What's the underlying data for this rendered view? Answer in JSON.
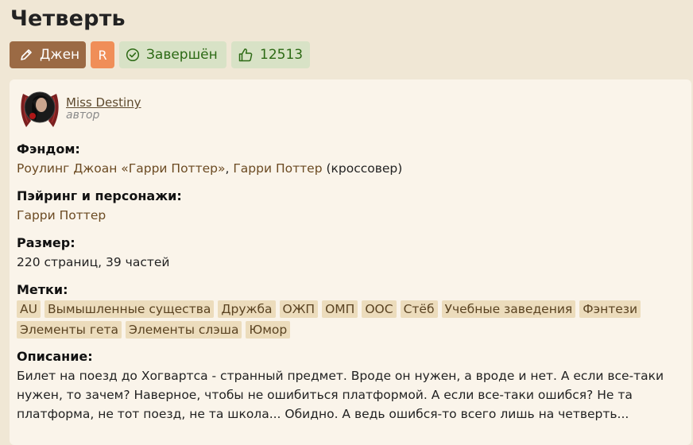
{
  "title": "Четверть",
  "badges": {
    "direction": "Джен",
    "rating": "R",
    "status": "Завершён",
    "likes": "12513"
  },
  "author": {
    "name": "Miss Destiny",
    "role": "автор"
  },
  "fandom": {
    "label": "Фэндом:",
    "link1": "Роулинг Джоан «Гарри Поттер»",
    "sep": ", ",
    "link2": "Гарри Поттер",
    "suffix": " (кроссовер)"
  },
  "pairing": {
    "label": "Пэйринг и персонажи:",
    "value": "Гарри Поттер"
  },
  "size": {
    "label": "Размер:",
    "value": "220 страниц, 39 частей"
  },
  "tags": {
    "label": "Метки:",
    "items": [
      "AU",
      "Вымышленные существа",
      "Дружба",
      "ОЖП",
      "ОМП",
      "ООС",
      "Стёб",
      "Учебные заведения",
      "Фэнтези",
      "Элементы гета",
      "Элементы слэша",
      "Юмор"
    ]
  },
  "description": {
    "label": "Описание:",
    "text": "Билет на поезд до Хогвартса - странный предмет. Вроде он нужен, а вроде и нет. А если все-таки нужен, то зачем? Наверное, чтобы не ошибиться платформой. А если все-таки ошибся? Не та платформа, не тот поезд, не та школа... Обидно. А ведь ошибся-то всего лишь на четверть..."
  },
  "colors": {
    "page_bg": "#f0e7d5",
    "card_bg": "#faf4ea",
    "gen_badge": "#9b6a44",
    "rating_badge": "#f08e58",
    "status_badge": "#d8e2c6",
    "status_text": "#2d6a15",
    "tag_bg": "#ecdcbc"
  },
  "icons": {
    "direction": "pencil-icon",
    "status": "check-circle-icon",
    "likes": "thumbs-up-icon"
  }
}
